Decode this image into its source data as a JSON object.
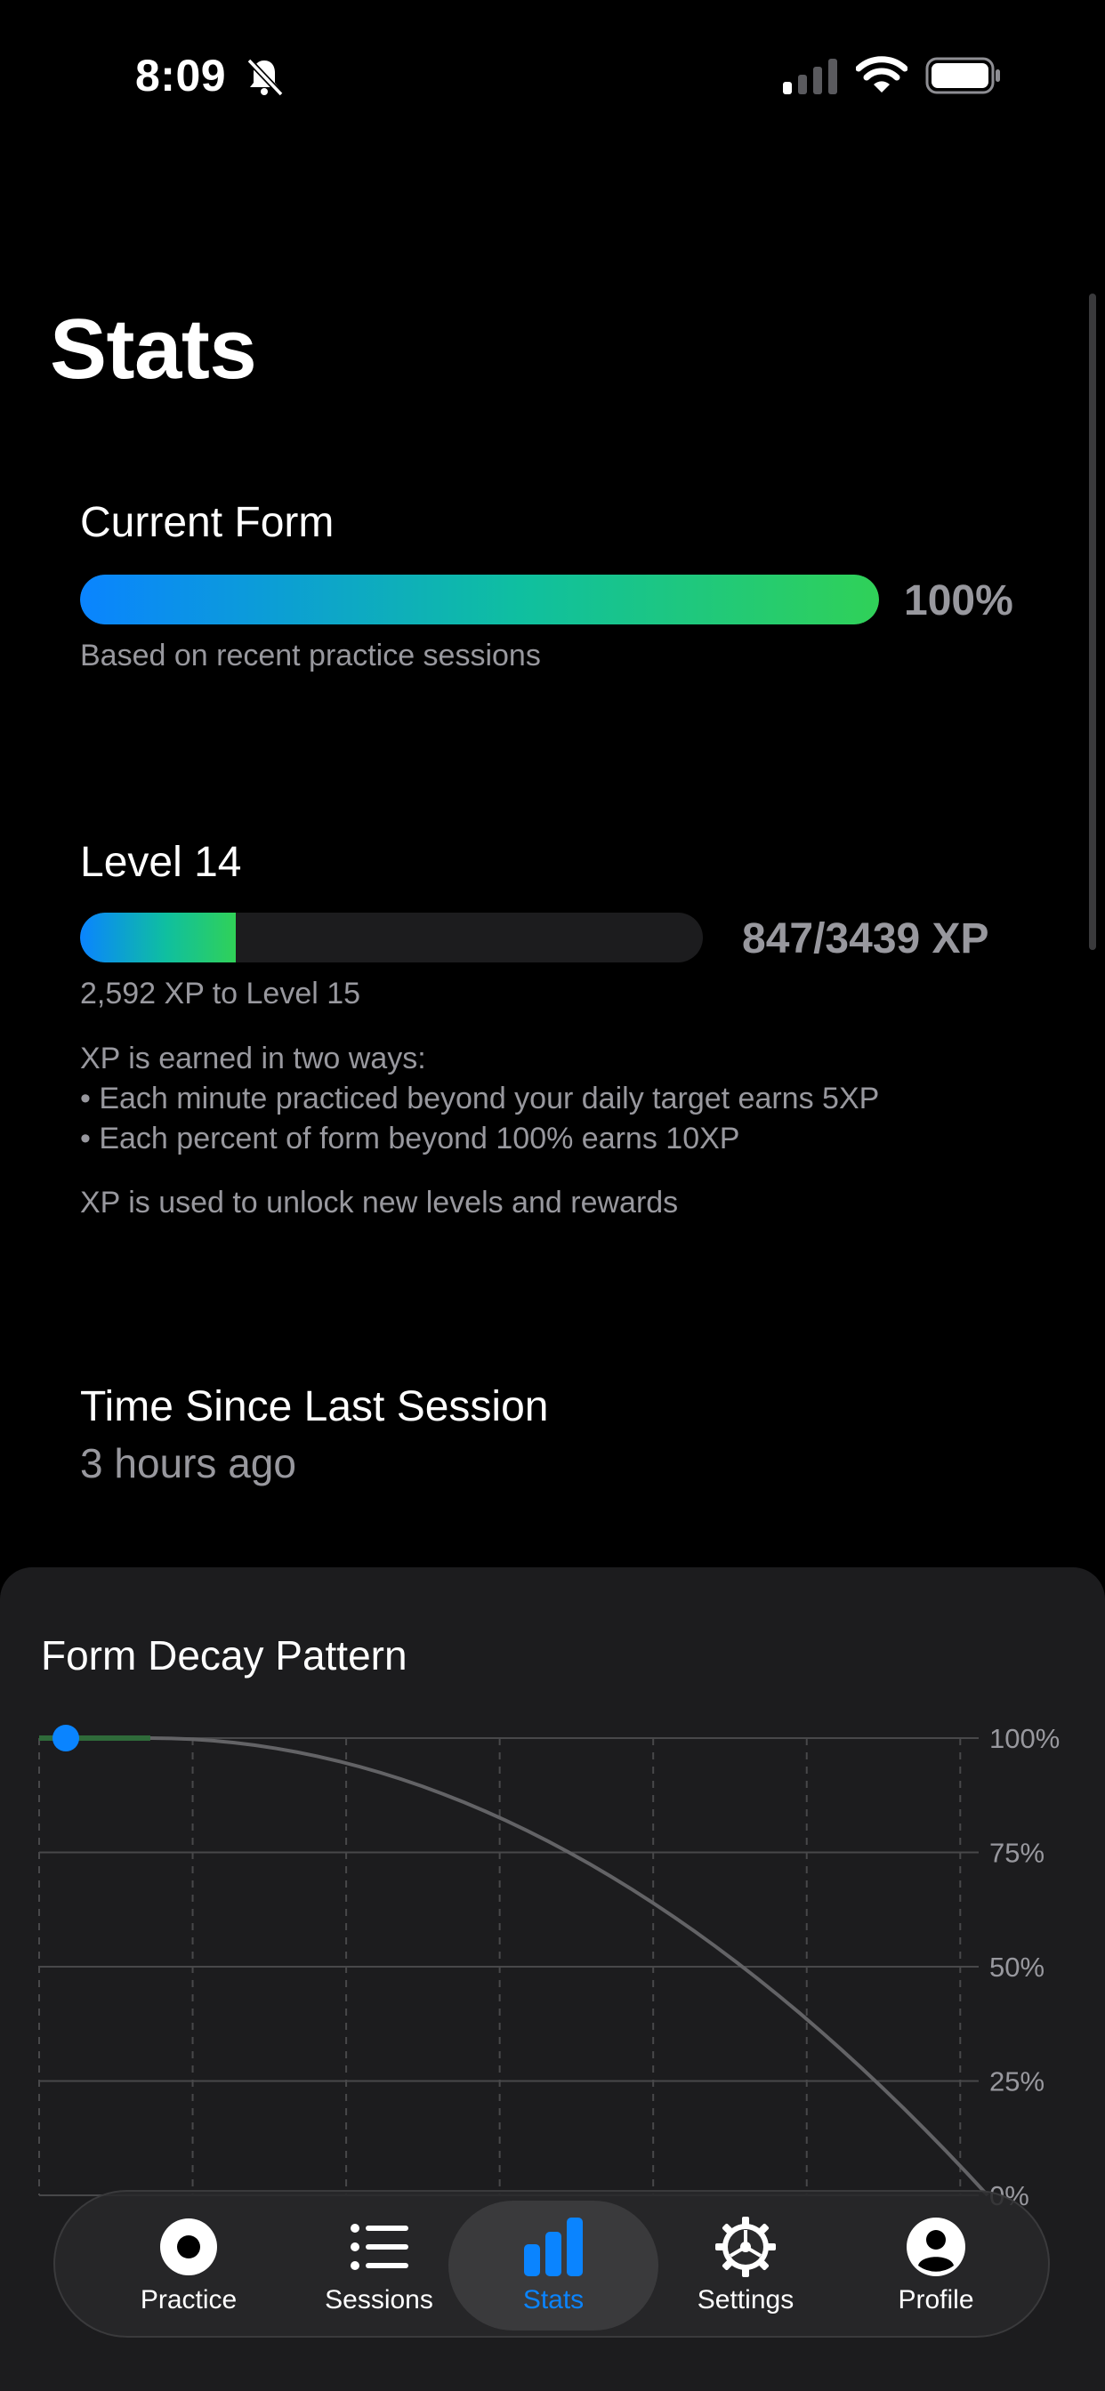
{
  "status_bar": {
    "time": "8:09"
  },
  "page": {
    "title": "Stats"
  },
  "current_form": {
    "title": "Current Form",
    "percent_label": "100%",
    "value": 1.0,
    "caption": "Based on recent practice sessions"
  },
  "level": {
    "title": "Level 14",
    "xp_label": "847/3439 XP",
    "progress": 0.25,
    "to_next": "2,592 XP to Level 15",
    "info_line1": "XP is earned in two ways:",
    "info_line2": "• Each minute practiced beyond your daily target earns 5XP",
    "info_line3": "• Each percent of form beyond 100% earns 10XP",
    "info_line4": "XP is used to unlock new levels and rewards"
  },
  "last_session": {
    "title": "Time Since Last Session",
    "value": "3 hours ago"
  },
  "chart_data": {
    "type": "line",
    "title": "Form Decay Pattern",
    "y_ticks": [
      "100%",
      "75%",
      "50%",
      "25%",
      "0%"
    ],
    "ylim": [
      0,
      100
    ],
    "current_marker": 100
  },
  "tabs": [
    {
      "label": "Practice",
      "icon": "record-icon"
    },
    {
      "label": "Sessions",
      "icon": "list-icon"
    },
    {
      "label": "Stats",
      "icon": "bar-chart-icon",
      "active": true
    },
    {
      "label": "Settings",
      "icon": "gear-icon"
    },
    {
      "label": "Profile",
      "icon": "person-circle-icon"
    }
  ],
  "colors": {
    "accent": "#0a84ff",
    "green": "#30d158",
    "background": "#000000",
    "card": "#1c1c1e"
  }
}
